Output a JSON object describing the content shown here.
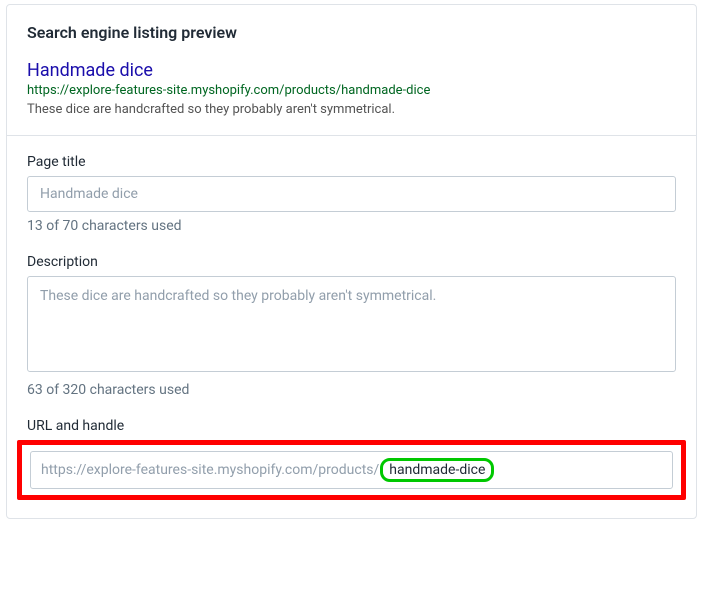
{
  "heading": "Search engine listing preview",
  "preview": {
    "title": "Handmade dice",
    "url": "https://explore-features-site.myshopify.com/products/handmade-dice",
    "description": "These dice are handcrafted so they probably aren't symmetrical."
  },
  "fields": {
    "page_title": {
      "label": "Page title",
      "value": "Handmade dice",
      "helper": "13 of 70 characters used"
    },
    "description": {
      "label": "Description",
      "value": "These dice are handcrafted so they probably aren't symmetrical.",
      "helper": "63 of 320 characters used"
    },
    "url_handle": {
      "label": "URL and handle",
      "prefix": "https://explore-features-site.myshopify.com/products/",
      "handle": "handmade-dice"
    }
  }
}
